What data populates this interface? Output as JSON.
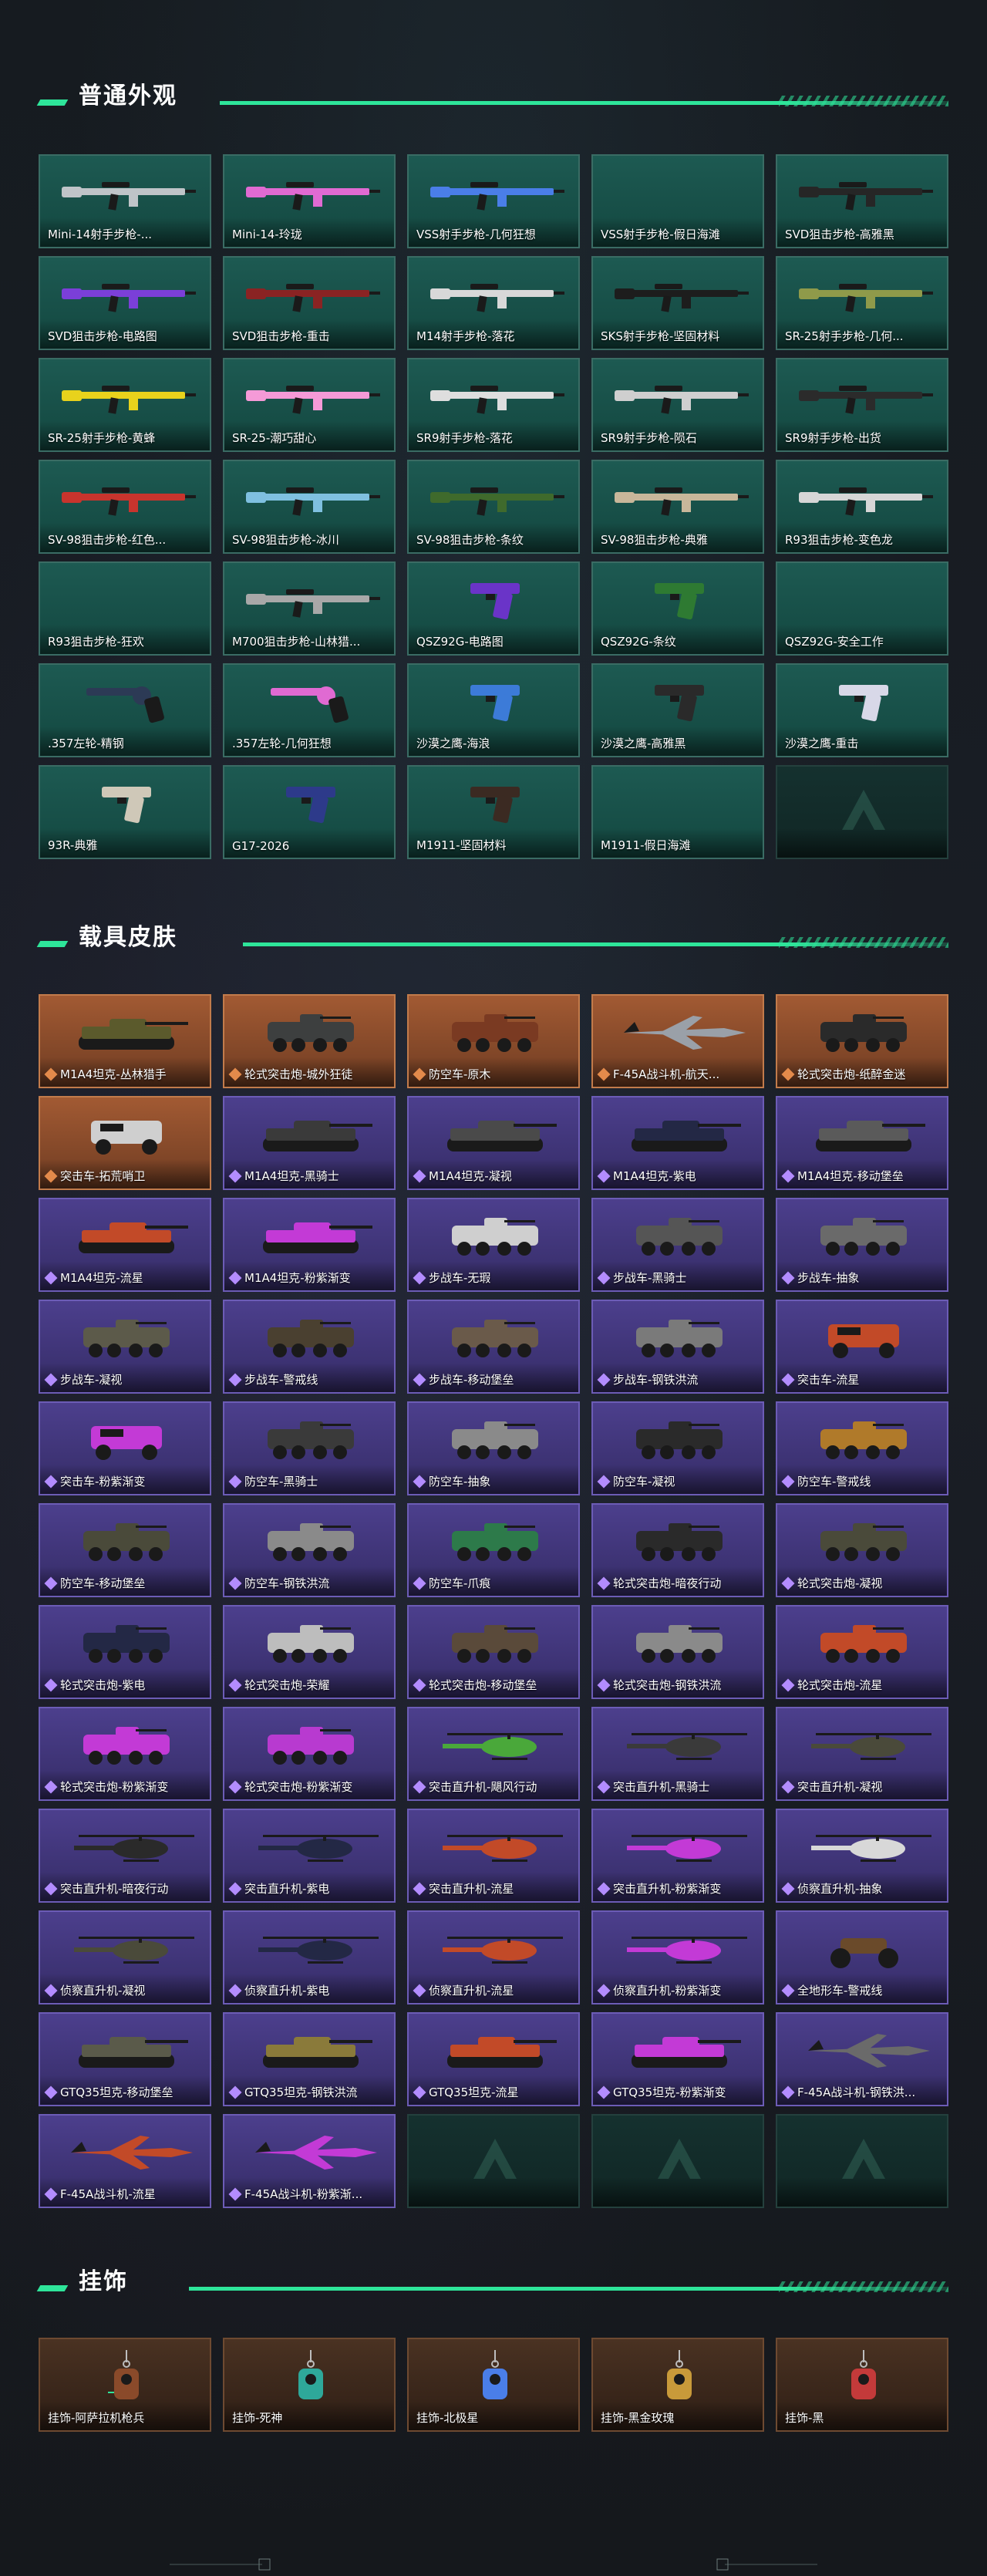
{
  "colors": {
    "accent": "#2ee59a",
    "weapon_card": "#1d5a52",
    "vehicle_orange": "#a25a33",
    "vehicle_purple": "#4c3f8d",
    "pendant_card": "#4a3222"
  },
  "sections": [
    {
      "title": "普通外观",
      "items": [
        {
          "label": "Mini-14射手步枪-...",
          "kind": "rifle",
          "color": "#bfc4c8"
        },
        {
          "label": "Mini-14-玲珑",
          "kind": "rifle",
          "color": "#e06ad2"
        },
        {
          "label": "VSS射手步枪-几何狂想",
          "kind": "rifle",
          "color": "#4a7ee8"
        },
        {
          "label": "VSS射手步枪-假日海滩",
          "kind": "empty"
        },
        {
          "label": "SVD狙击步枪-高雅黑",
          "kind": "rifle",
          "color": "#262626"
        },
        {
          "label": "SVD狙击步枪-电路图",
          "kind": "rifle",
          "color": "#7b3fd8"
        },
        {
          "label": "SVD狙击步枪-重击",
          "kind": "rifle",
          "color": "#8a2323"
        },
        {
          "label": "M14射手步枪-落花",
          "kind": "rifle",
          "color": "#d8d8d8"
        },
        {
          "label": "SKS射手步枪-坚固材料",
          "kind": "rifle",
          "color": "#1d1d1d"
        },
        {
          "label": "SR-25射手步枪-几何...",
          "kind": "rifle",
          "color": "#8f9a4a"
        },
        {
          "label": "SR-25射手步枪-黄蜂",
          "kind": "rifle",
          "color": "#e8d21c"
        },
        {
          "label": "SR-25-潮巧甜心",
          "kind": "rifle",
          "color": "#f59ad7"
        },
        {
          "label": "SR9射手步枪-落花",
          "kind": "rifle",
          "color": "#dedede"
        },
        {
          "label": "SR9射手步枪-陨石",
          "kind": "rifle",
          "color": "#cfcfcf"
        },
        {
          "label": "SR9射手步枪-出货",
          "kind": "rifle",
          "color": "#2b2b2b"
        },
        {
          "label": "SV-98狙击步枪-红色...",
          "kind": "rifle",
          "color": "#c8342d"
        },
        {
          "label": "SV-98狙击步枪-冰川",
          "kind": "rifle",
          "color": "#7fc0e0"
        },
        {
          "label": "SV-98狙击步枪-条纹",
          "kind": "rifle",
          "color": "#3f6a2c"
        },
        {
          "label": "SV-98狙击步枪-典雅",
          "kind": "rifle",
          "color": "#c8b79a"
        },
        {
          "label": "R93狙击步枪-变色龙",
          "kind": "rifle",
          "color": "#d6d6d6"
        },
        {
          "label": "R93狙击步枪-狂欢",
          "kind": "empty"
        },
        {
          "label": "M700狙击步枪-山林猎...",
          "kind": "rifle",
          "color": "#a8a8a8"
        },
        {
          "label": "QSZ92G-电路图",
          "kind": "pistol",
          "color": "#6a34c8"
        },
        {
          "label": "QSZ92G-条纹",
          "kind": "pistol",
          "color": "#2e7a32"
        },
        {
          "label": "QSZ92G-安全工作",
          "kind": "empty"
        },
        {
          "label": ".357左轮-精钢",
          "kind": "revolver",
          "color": "#2c3a55"
        },
        {
          "label": ".357左轮-几何狂想",
          "kind": "revolver",
          "color": "#e06ad2"
        },
        {
          "label": "沙漠之鹰-海浪",
          "kind": "pistol",
          "color": "#3c7bd8"
        },
        {
          "label": "沙漠之鹰-高雅黑",
          "kind": "pistol",
          "color": "#2a2a2a"
        },
        {
          "label": "沙漠之鹰-重击",
          "kind": "pistol",
          "color": "#d8d8e8"
        },
        {
          "label": "93R-典雅",
          "kind": "pistol",
          "color": "#cfc8b8"
        },
        {
          "label": "G17-2026",
          "kind": "pistol",
          "color": "#2d3a8a"
        },
        {
          "label": "M1911-坚固材料",
          "kind": "pistol",
          "color": "#3b2a22"
        },
        {
          "label": "M1911-假日海滩",
          "kind": "empty"
        },
        {
          "label": "",
          "kind": "placeholder"
        }
      ]
    },
    {
      "title": "载具皮肤",
      "items": [
        {
          "label": "M1A4坦克-丛林猎手",
          "kind": "tank",
          "tier": "orange",
          "color": "#5b5a2c"
        },
        {
          "label": "轮式突击炮-城外狂徒",
          "kind": "apc",
          "tier": "orange",
          "color": "#3d3f3f"
        },
        {
          "label": "防空车-原木",
          "kind": "apc",
          "tier": "orange",
          "color": "#7a3a22"
        },
        {
          "label": "F-45A战斗机-航天...",
          "kind": "jet",
          "tier": "orange",
          "color": "#9aa0a8"
        },
        {
          "label": "轮式突击炮-纸醉金迷",
          "kind": "apc",
          "tier": "orange",
          "color": "#2a2a2a"
        },
        {
          "label": "突击车-拓荒哨卫",
          "kind": "truck",
          "tier": "orange",
          "color": "#cfcfcf"
        },
        {
          "label": "M1A4坦克-黑骑士",
          "kind": "tank",
          "tier": "purple",
          "color": "#3a3a3a"
        },
        {
          "label": "M1A4坦克-凝视",
          "kind": "tank",
          "tier": "purple",
          "color": "#4a4a4a"
        },
        {
          "label": "M1A4坦克-紫电",
          "kind": "tank",
          "tier": "purple",
          "color": "#232845"
        },
        {
          "label": "M1A4坦克-移动堡垒",
          "kind": "tank",
          "tier": "purple",
          "color": "#5a5a5a"
        },
        {
          "label": "M1A4坦克-流星",
          "kind": "tank",
          "tier": "purple",
          "color": "#c24a28"
        },
        {
          "label": "M1A4坦克-粉紫渐变",
          "kind": "tank",
          "tier": "purple",
          "color": "#c33ad6"
        },
        {
          "label": "步战车-无瑕",
          "kind": "apc",
          "tier": "purple",
          "color": "#cfcfcf"
        },
        {
          "label": "步战车-黑骑士",
          "kind": "apc",
          "tier": "purple",
          "color": "#555555"
        },
        {
          "label": "步战车-抽象",
          "kind": "apc",
          "tier": "purple",
          "color": "#6a6a6a"
        },
        {
          "label": "步战车-凝视",
          "kind": "apc",
          "tier": "purple",
          "color": "#5c5a4a"
        },
        {
          "label": "步战车-警戒线",
          "kind": "apc",
          "tier": "purple",
          "color": "#4a4030"
        },
        {
          "label": "步战车-移动堡垒",
          "kind": "apc",
          "tier": "purple",
          "color": "#6a5a4a"
        },
        {
          "label": "步战车-钢铁洪流",
          "kind": "apc",
          "tier": "purple",
          "color": "#7a7a7a"
        },
        {
          "label": "突击车-流星",
          "kind": "truck",
          "tier": "purple",
          "color": "#c24a28"
        },
        {
          "label": "突击车-粉紫渐变",
          "kind": "truck",
          "tier": "purple",
          "color": "#c33ad6"
        },
        {
          "label": "防空车-黑骑士",
          "kind": "apc",
          "tier": "purple",
          "color": "#3a3a3a"
        },
        {
          "label": "防空车-抽象",
          "kind": "apc",
          "tier": "purple",
          "color": "#8a8a8a"
        },
        {
          "label": "防空车-凝视",
          "kind": "apc",
          "tier": "purple",
          "color": "#2a2a2a"
        },
        {
          "label": "防空车-警戒线",
          "kind": "apc",
          "tier": "purple",
          "color": "#b07a2a"
        },
        {
          "label": "防空车-移动堡垒",
          "kind": "apc",
          "tier": "purple",
          "color": "#4a4a3a"
        },
        {
          "label": "防空车-钢铁洪流",
          "kind": "apc",
          "tier": "purple",
          "color": "#8a8a8a"
        },
        {
          "label": "防空车-爪痕",
          "kind": "apc",
          "tier": "purple",
          "color": "#2d7a4a"
        },
        {
          "label": "轮式突击炮-暗夜行动",
          "kind": "apc",
          "tier": "purple",
          "color": "#2a2a2a"
        },
        {
          "label": "轮式突击炮-凝视",
          "kind": "apc",
          "tier": "purple",
          "color": "#4a4a3a"
        },
        {
          "label": "轮式突击炮-紫电",
          "kind": "apc",
          "tier": "purple",
          "color": "#232845"
        },
        {
          "label": "轮式突击炮-荣耀",
          "kind": "apc",
          "tier": "purple",
          "color": "#bdbdbd"
        },
        {
          "label": "轮式突击炮-移动堡垒",
          "kind": "apc",
          "tier": "purple",
          "color": "#5a4a3a"
        },
        {
          "label": "轮式突击炮-钢铁洪流",
          "kind": "apc",
          "tier": "purple",
          "color": "#8a8a8a"
        },
        {
          "label": "轮式突击炮-流星",
          "kind": "apc",
          "tier": "purple",
          "color": "#c24a28"
        },
        {
          "label": "轮式突击炮-粉紫渐变",
          "kind": "apc",
          "tier": "purple",
          "color": "#c33ad6"
        },
        {
          "label": "轮式突击炮-粉紫渐变",
          "kind": "apc",
          "tier": "purple",
          "color": "#b83ad0"
        },
        {
          "label": "突击直升机-飓风行动",
          "kind": "heli",
          "tier": "purple",
          "color": "#4aa83a"
        },
        {
          "label": "突击直升机-黑骑士",
          "kind": "heli",
          "tier": "purple",
          "color": "#3a3a3a"
        },
        {
          "label": "突击直升机-凝视",
          "kind": "heli",
          "tier": "purple",
          "color": "#4a4a3a"
        },
        {
          "label": "突击直升机-暗夜行动",
          "kind": "heli",
          "tier": "purple",
          "color": "#2a2a2a"
        },
        {
          "label": "突击直升机-紫电",
          "kind": "heli",
          "tier": "purple",
          "color": "#232845"
        },
        {
          "label": "突击直升机-流星",
          "kind": "heli",
          "tier": "purple",
          "color": "#c24a28"
        },
        {
          "label": "突击直升机-粉紫渐变",
          "kind": "heli",
          "tier": "purple",
          "color": "#c33ad6"
        },
        {
          "label": "侦察直升机-抽象",
          "kind": "heli",
          "tier": "purple",
          "color": "#d8d8d8"
        },
        {
          "label": "侦察直升机-凝视",
          "kind": "heli",
          "tier": "purple",
          "color": "#4a4a3a"
        },
        {
          "label": "侦察直升机-紫电",
          "kind": "heli",
          "tier": "purple",
          "color": "#232845"
        },
        {
          "label": "侦察直升机-流星",
          "kind": "heli",
          "tier": "purple",
          "color": "#c24a28"
        },
        {
          "label": "侦察直升机-粉紫渐变",
          "kind": "heli",
          "tier": "purple",
          "color": "#c33ad6"
        },
        {
          "label": "全地形车-警戒线",
          "kind": "atv",
          "tier": "purple",
          "color": "#6a4a2a"
        },
        {
          "label": "GTQ35坦克-移动堡垒",
          "kind": "tank",
          "tier": "purple",
          "color": "#5a5a4a"
        },
        {
          "label": "GTQ35坦克-钢铁洪流",
          "kind": "tank",
          "tier": "purple",
          "color": "#8a7a3a"
        },
        {
          "label": "GTQ35坦克-流星",
          "kind": "tank",
          "tier": "purple",
          "color": "#c24a28"
        },
        {
          "label": "GTQ35坦克-粉紫渐变",
          "kind": "tank",
          "tier": "purple",
          "color": "#c33ad6"
        },
        {
          "label": "F-45A战斗机-钢铁洪...",
          "kind": "jet",
          "tier": "purple",
          "color": "#6a6a6a"
        },
        {
          "label": "F-45A战斗机-流星",
          "kind": "jet",
          "tier": "purple",
          "color": "#c24a28"
        },
        {
          "label": "F-45A战斗机-粉紫渐...",
          "kind": "jet",
          "tier": "purple",
          "color": "#c33ad6"
        },
        {
          "label": "",
          "kind": "placeholder"
        },
        {
          "label": "",
          "kind": "placeholder"
        },
        {
          "label": "",
          "kind": "placeholder"
        }
      ]
    },
    {
      "title": "挂饰",
      "items": [
        {
          "label": "挂饰-阿萨拉机枪兵",
          "kind": "charm",
          "color": "#8a4a2a"
        },
        {
          "label": "挂饰-死神",
          "kind": "charm",
          "color": "#2ea89a"
        },
        {
          "label": "挂饰-北极星",
          "kind": "charm",
          "color": "#4a7ee8"
        },
        {
          "label": "挂饰-黑金玫瑰",
          "kind": "charm",
          "color": "#c89a3a"
        },
        {
          "label": "挂饰-黑",
          "kind": "charm",
          "color": "#c33a3a"
        }
      ]
    }
  ]
}
